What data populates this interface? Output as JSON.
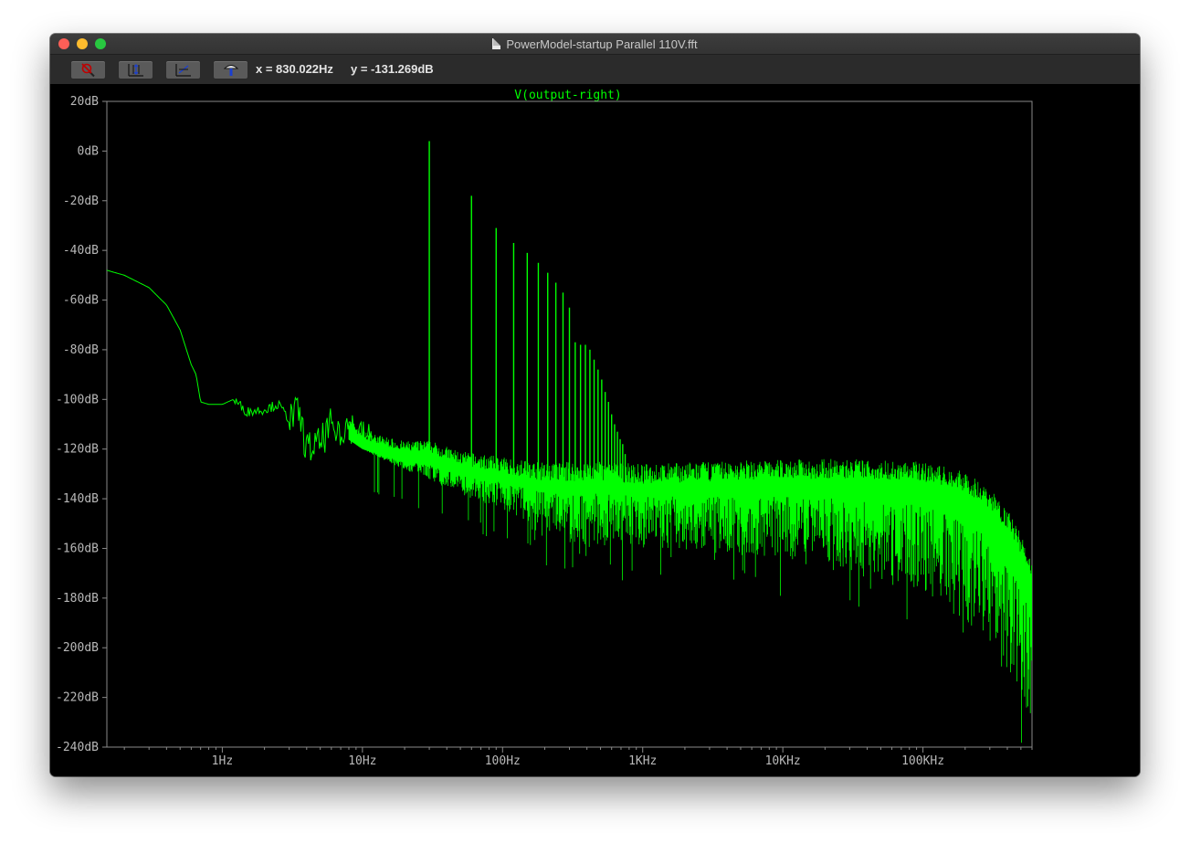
{
  "window": {
    "title": "PowerModel-startup Parallel 110V.fft"
  },
  "toolbar": {
    "buttons": [
      "zoom-cancel-icon",
      "autorange-y-icon",
      "autorange-x-icon",
      "probe-icon"
    ],
    "cursor_x": "x = 830.022Hz",
    "cursor_y": "y = -131.269dB"
  },
  "colors": {
    "trace": "#00ff00",
    "grid_text": "#b8b8b8",
    "background": "#000000"
  },
  "chart_data": {
    "type": "line",
    "title": "V(output-right)",
    "xscale": "log",
    "xlim": [
      0.15,
      600000
    ],
    "ylim": [
      -240,
      20
    ],
    "grid": false,
    "yticks": [
      "20dB",
      "0dB",
      "-20dB",
      "-40dB",
      "-60dB",
      "-80dB",
      "-100dB",
      "-120dB",
      "-140dB",
      "-160dB",
      "-180dB",
      "-200dB",
      "-220dB",
      "-240dB"
    ],
    "xticks": [
      "1Hz",
      "10Hz",
      "100Hz",
      "1KHz",
      "10KHz",
      "100KHz"
    ],
    "series": [
      {
        "name": "V(output-right)",
        "baseline": {
          "x": [
            0.15,
            0.2,
            0.3,
            0.4,
            0.5,
            0.6,
            0.65,
            0.7,
            0.8,
            1.0,
            1.2,
            1.5,
            2.0,
            2.5,
            3.0,
            3.5,
            4.0,
            5.0,
            6.0,
            7.0,
            8.0,
            10,
            15,
            20,
            30,
            50,
            100,
            200,
            500,
            1000,
            3000,
            10000,
            30000,
            100000,
            200000,
            300000,
            400000,
            500000,
            600000
          ],
          "y": [
            -48,
            -50,
            -55,
            -62,
            -72,
            -86,
            -90,
            -101,
            -102,
            -102,
            -100,
            -105,
            -104,
            -102,
            -108,
            -105,
            -120,
            -118,
            -110,
            -112,
            -110,
            -115,
            -118,
            -120,
            -120,
            -125,
            -128,
            -131,
            -131,
            -132,
            -131,
            -130,
            -130,
            -131,
            -135,
            -142,
            -150,
            -160,
            -170
          ]
        },
        "peaks": {
          "x": [
            30,
            60,
            90,
            120,
            150,
            180,
            210,
            240,
            270,
            300,
            330,
            360,
            390,
            420,
            450,
            480,
            510,
            540,
            570,
            600,
            630,
            660,
            690,
            720,
            750
          ],
          "y": [
            4,
            -18,
            -31,
            -37,
            -41,
            -45,
            -49,
            -53,
            -57,
            -63,
            -77,
            -78,
            -78,
            -80,
            -84,
            -88,
            -92,
            -97,
            -101,
            -106,
            -110,
            -113,
            -116,
            -118,
            -122
          ]
        },
        "floor": {
          "x": [
            10,
            30,
            100,
            300,
            1000,
            3000,
            10000,
            30000,
            100000,
            200000,
            300000,
            400000,
            500000,
            600000
          ],
          "y": [
            -135,
            -145,
            -150,
            -158,
            -160,
            -162,
            -165,
            -170,
            -178,
            -190,
            -200,
            -212,
            -225,
            -235
          ]
        }
      }
    ]
  }
}
